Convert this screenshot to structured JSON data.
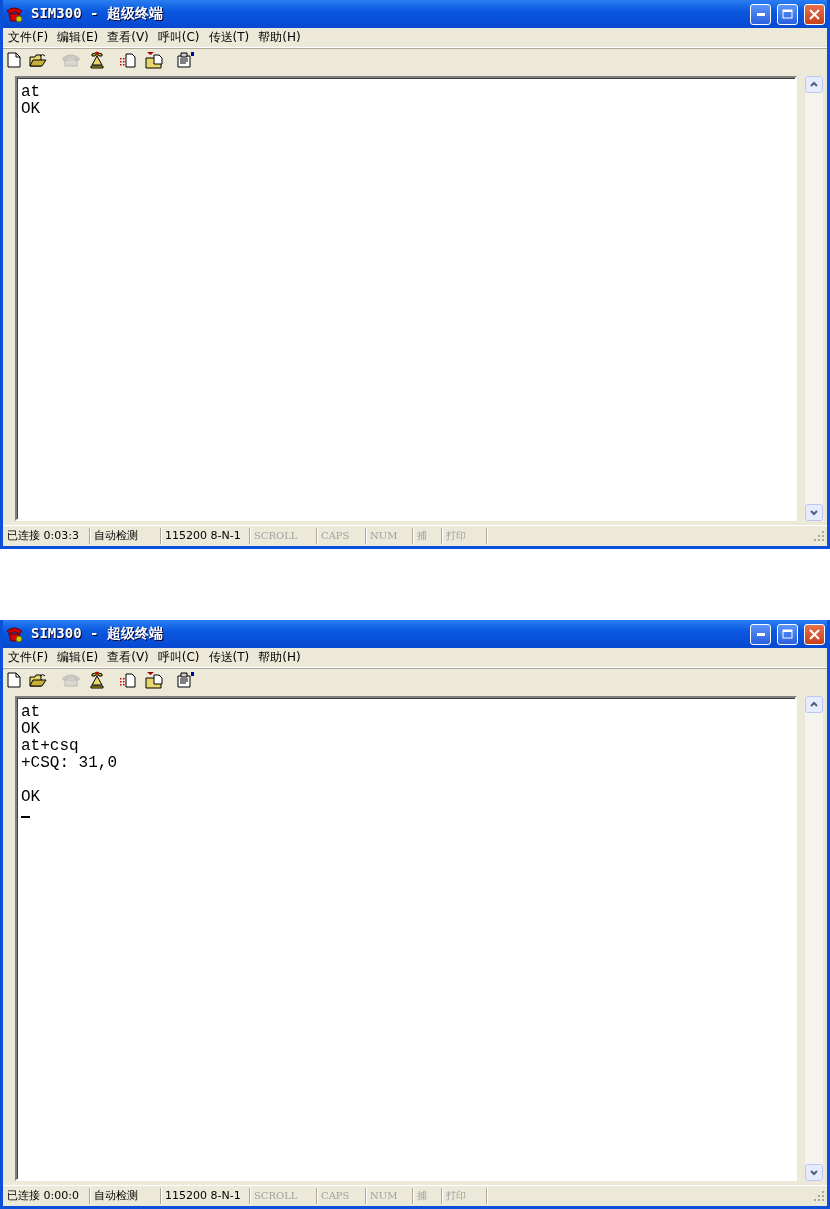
{
  "windows": [
    {
      "title": "SIM300 - 超级终端",
      "menu": [
        "文件(F)",
        "编辑(E)",
        "查看(V)",
        "呼叫(C)",
        "传送(T)",
        "帮助(H)"
      ],
      "toolbar": [
        {
          "kind": "new",
          "disabled": false
        },
        {
          "kind": "open",
          "disabled": false
        },
        {
          "kind": "call",
          "disabled": true
        },
        {
          "kind": "hangup",
          "disabled": false
        },
        {
          "kind": "send",
          "disabled": false
        },
        {
          "kind": "receive",
          "disabled": false
        },
        {
          "kind": "properties",
          "disabled": false
        }
      ],
      "terminal": {
        "lines": [
          {
            "text": "at",
            "blank_before": false
          },
          {
            "text": "OK",
            "blank_before": false
          }
        ],
        "cursor": false
      },
      "status_bar": [
        {
          "text": "已连接 0:03:3",
          "disabled": false
        },
        {
          "text": "自动检测",
          "disabled": false
        },
        {
          "text": "115200 8-N-1",
          "disabled": false
        },
        {
          "text": "SCROLL",
          "disabled": true
        },
        {
          "text": "CAPS",
          "disabled": true
        },
        {
          "text": "NUM",
          "disabled": true
        },
        {
          "text": "捕",
          "disabled": true
        },
        {
          "text": "打印",
          "disabled": true
        }
      ]
    },
    {
      "title": "SIM300 - 超级终端",
      "menu": [
        "文件(F)",
        "编辑(E)",
        "查看(V)",
        "呼叫(C)",
        "传送(T)",
        "帮助(H)"
      ],
      "toolbar": [
        {
          "kind": "new",
          "disabled": false
        },
        {
          "kind": "open",
          "disabled": false
        },
        {
          "kind": "call",
          "disabled": true
        },
        {
          "kind": "hangup",
          "disabled": false
        },
        {
          "kind": "send",
          "disabled": false
        },
        {
          "kind": "receive",
          "disabled": false
        },
        {
          "kind": "properties",
          "disabled": false
        }
      ],
      "terminal": {
        "lines": [
          {
            "text": "at",
            "blank_before": false
          },
          {
            "text": "OK",
            "blank_before": false
          },
          {
            "text": "at+csq",
            "blank_before": false
          },
          {
            "text": "+CSQ: 31,0",
            "blank_before": false
          },
          {
            "text": "OK",
            "blank_before": true
          }
        ],
        "cursor": true
      },
      "status_bar": [
        {
          "text": "已连接 0:00:0",
          "disabled": false
        },
        {
          "text": "自动检测",
          "disabled": false
        },
        {
          "text": "115200 8-N-1",
          "disabled": false
        },
        {
          "text": "SCROLL",
          "disabled": true
        },
        {
          "text": "CAPS",
          "disabled": true
        },
        {
          "text": "NUM",
          "disabled": true
        },
        {
          "text": "捕",
          "disabled": true
        },
        {
          "text": "打印",
          "disabled": true
        }
      ]
    }
  ]
}
